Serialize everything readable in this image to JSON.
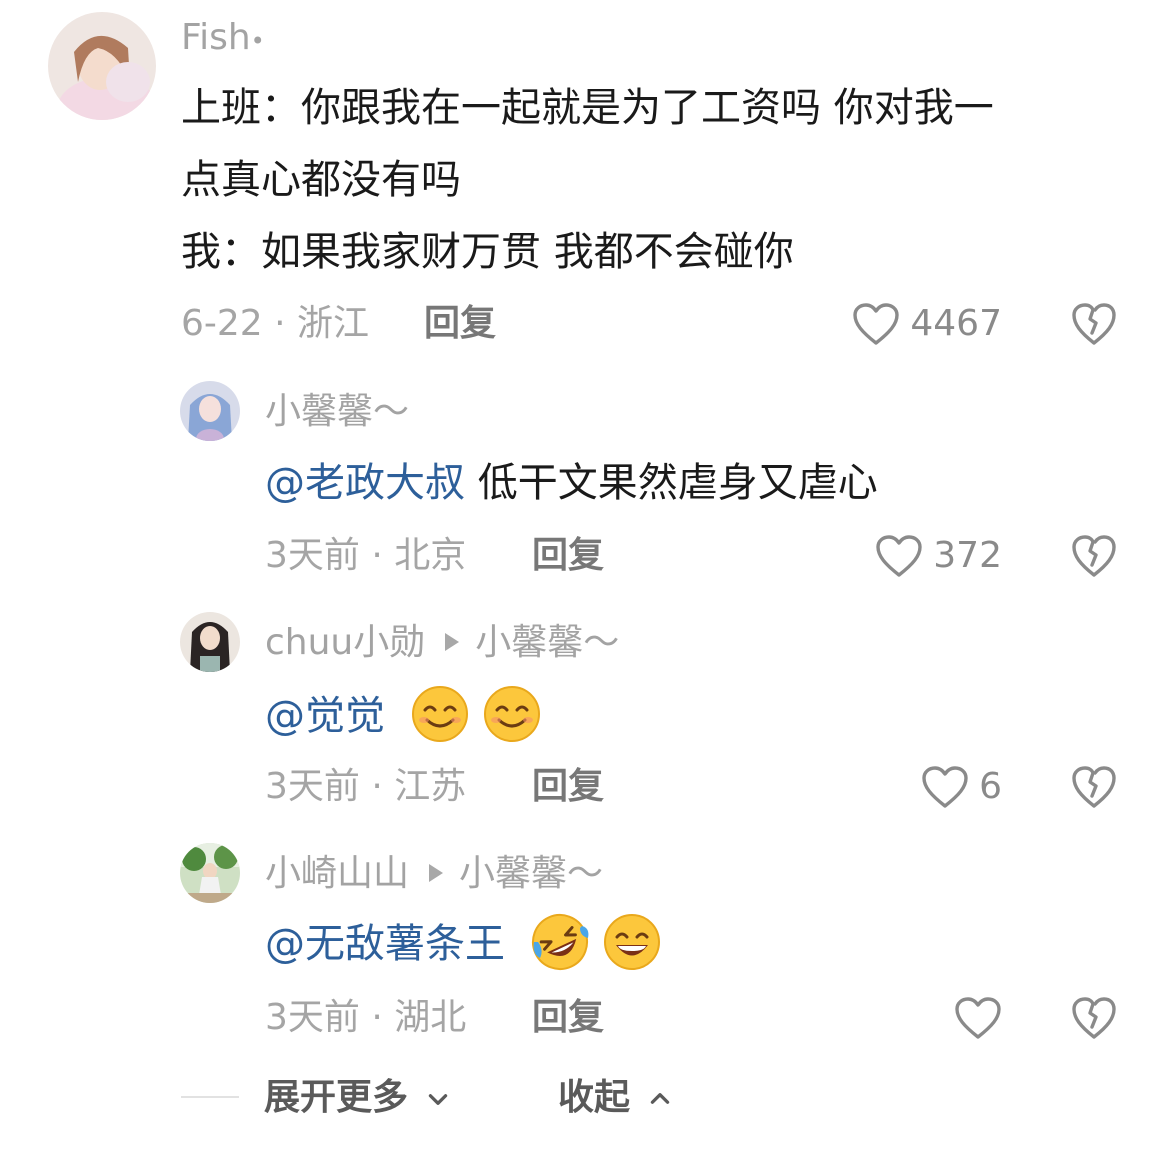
{
  "comments": [
    {
      "username": "Fish",
      "username_suffix": "•",
      "text_lines": [
        "上班：你跟我在一起就是为了工资吗 你对我一",
        "点真心都没有吗",
        "我：如果我家财万贯 我都不会碰你"
      ],
      "date": "6-22",
      "location": "浙江",
      "reply_label": "回复",
      "likes": "4467"
    },
    {
      "username": "小馨馨～",
      "mention": "@老政大叔",
      "text": " 低干文果然虐身又虐心",
      "date": "3天前",
      "location": "北京",
      "reply_label": "回复",
      "likes": "372"
    },
    {
      "username": "chuu小勋",
      "reply_to": "小馨馨～",
      "mention": "@觉觉",
      "emojis": [
        "smile-emoji",
        "smile-emoji"
      ],
      "date": "3天前",
      "location": "江苏",
      "reply_label": "回复",
      "likes": "6"
    },
    {
      "username": "小崎山山",
      "reply_to": "小馨馨～",
      "mention": "@无敌薯条王",
      "emojis": [
        "rofl-emoji",
        "grin-emoji"
      ],
      "date": "3天前",
      "location": "湖北",
      "reply_label": "回复",
      "likes": ""
    }
  ],
  "separator": " · ",
  "footer": {
    "expand_label": "展开更多",
    "collapse_label": "收起"
  },
  "colors": {
    "mention": "#2d5f9a",
    "meta": "#a5a5a5",
    "username": "#a3a3a3"
  }
}
